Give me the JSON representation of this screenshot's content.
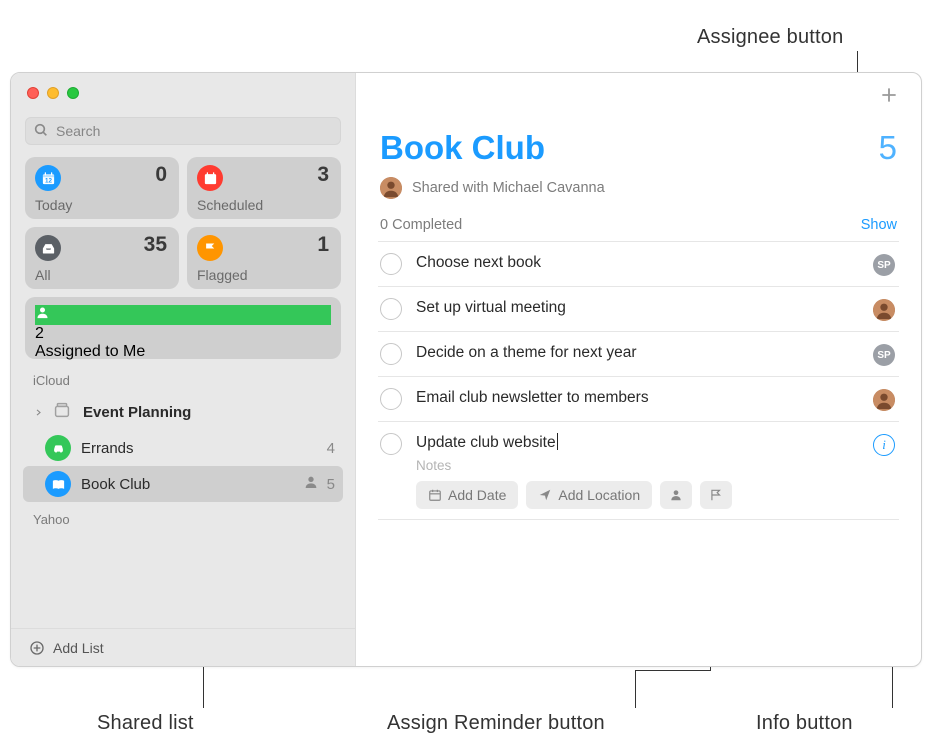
{
  "annotations": {
    "assignee_button": "Assignee button",
    "shared_list": "Shared list",
    "assign_reminder": "Assign Reminder button",
    "info_button": "Info button"
  },
  "sidebar": {
    "search_placeholder": "Search",
    "smart": {
      "today": {
        "label": "Today",
        "count": 0
      },
      "scheduled": {
        "label": "Scheduled",
        "count": 3
      },
      "all": {
        "label": "All",
        "count": 35
      },
      "flagged": {
        "label": "Flagged",
        "count": 1
      },
      "assigned": {
        "label": "Assigned to Me",
        "count": 2
      }
    },
    "sections": {
      "icloud": "iCloud",
      "yahoo": "Yahoo"
    },
    "lists": {
      "event_planning": {
        "name": "Event Planning"
      },
      "errands": {
        "name": "Errands",
        "count": 4
      },
      "book_club": {
        "name": "Book Club",
        "count": 5
      }
    },
    "add_list": "Add List"
  },
  "main": {
    "title": "Book Club",
    "total": 5,
    "shared_with": "Shared with Michael Cavanna",
    "completed_label": "0 Completed",
    "show_label": "Show",
    "items": [
      {
        "title": "Choose next book",
        "assignee_initials": "SP"
      },
      {
        "title": "Set up virtual meeting",
        "assignee_photo": true
      },
      {
        "title": "Decide on a theme for next year",
        "assignee_initials": "SP"
      },
      {
        "title": "Email club newsletter to members",
        "assignee_photo": true
      },
      {
        "title": "Update club website",
        "editing": true
      }
    ],
    "editor": {
      "notes_placeholder": "Notes",
      "add_date": "Add Date",
      "add_location": "Add Location"
    }
  },
  "colors": {
    "accent": "#1b9bff",
    "today": "#1b9bff",
    "scheduled": "#ff3b30",
    "all": "#5b6066",
    "flagged": "#ff9500",
    "assigned": "#34c759",
    "errands": "#34c759",
    "bookclub": "#1b9bff"
  }
}
